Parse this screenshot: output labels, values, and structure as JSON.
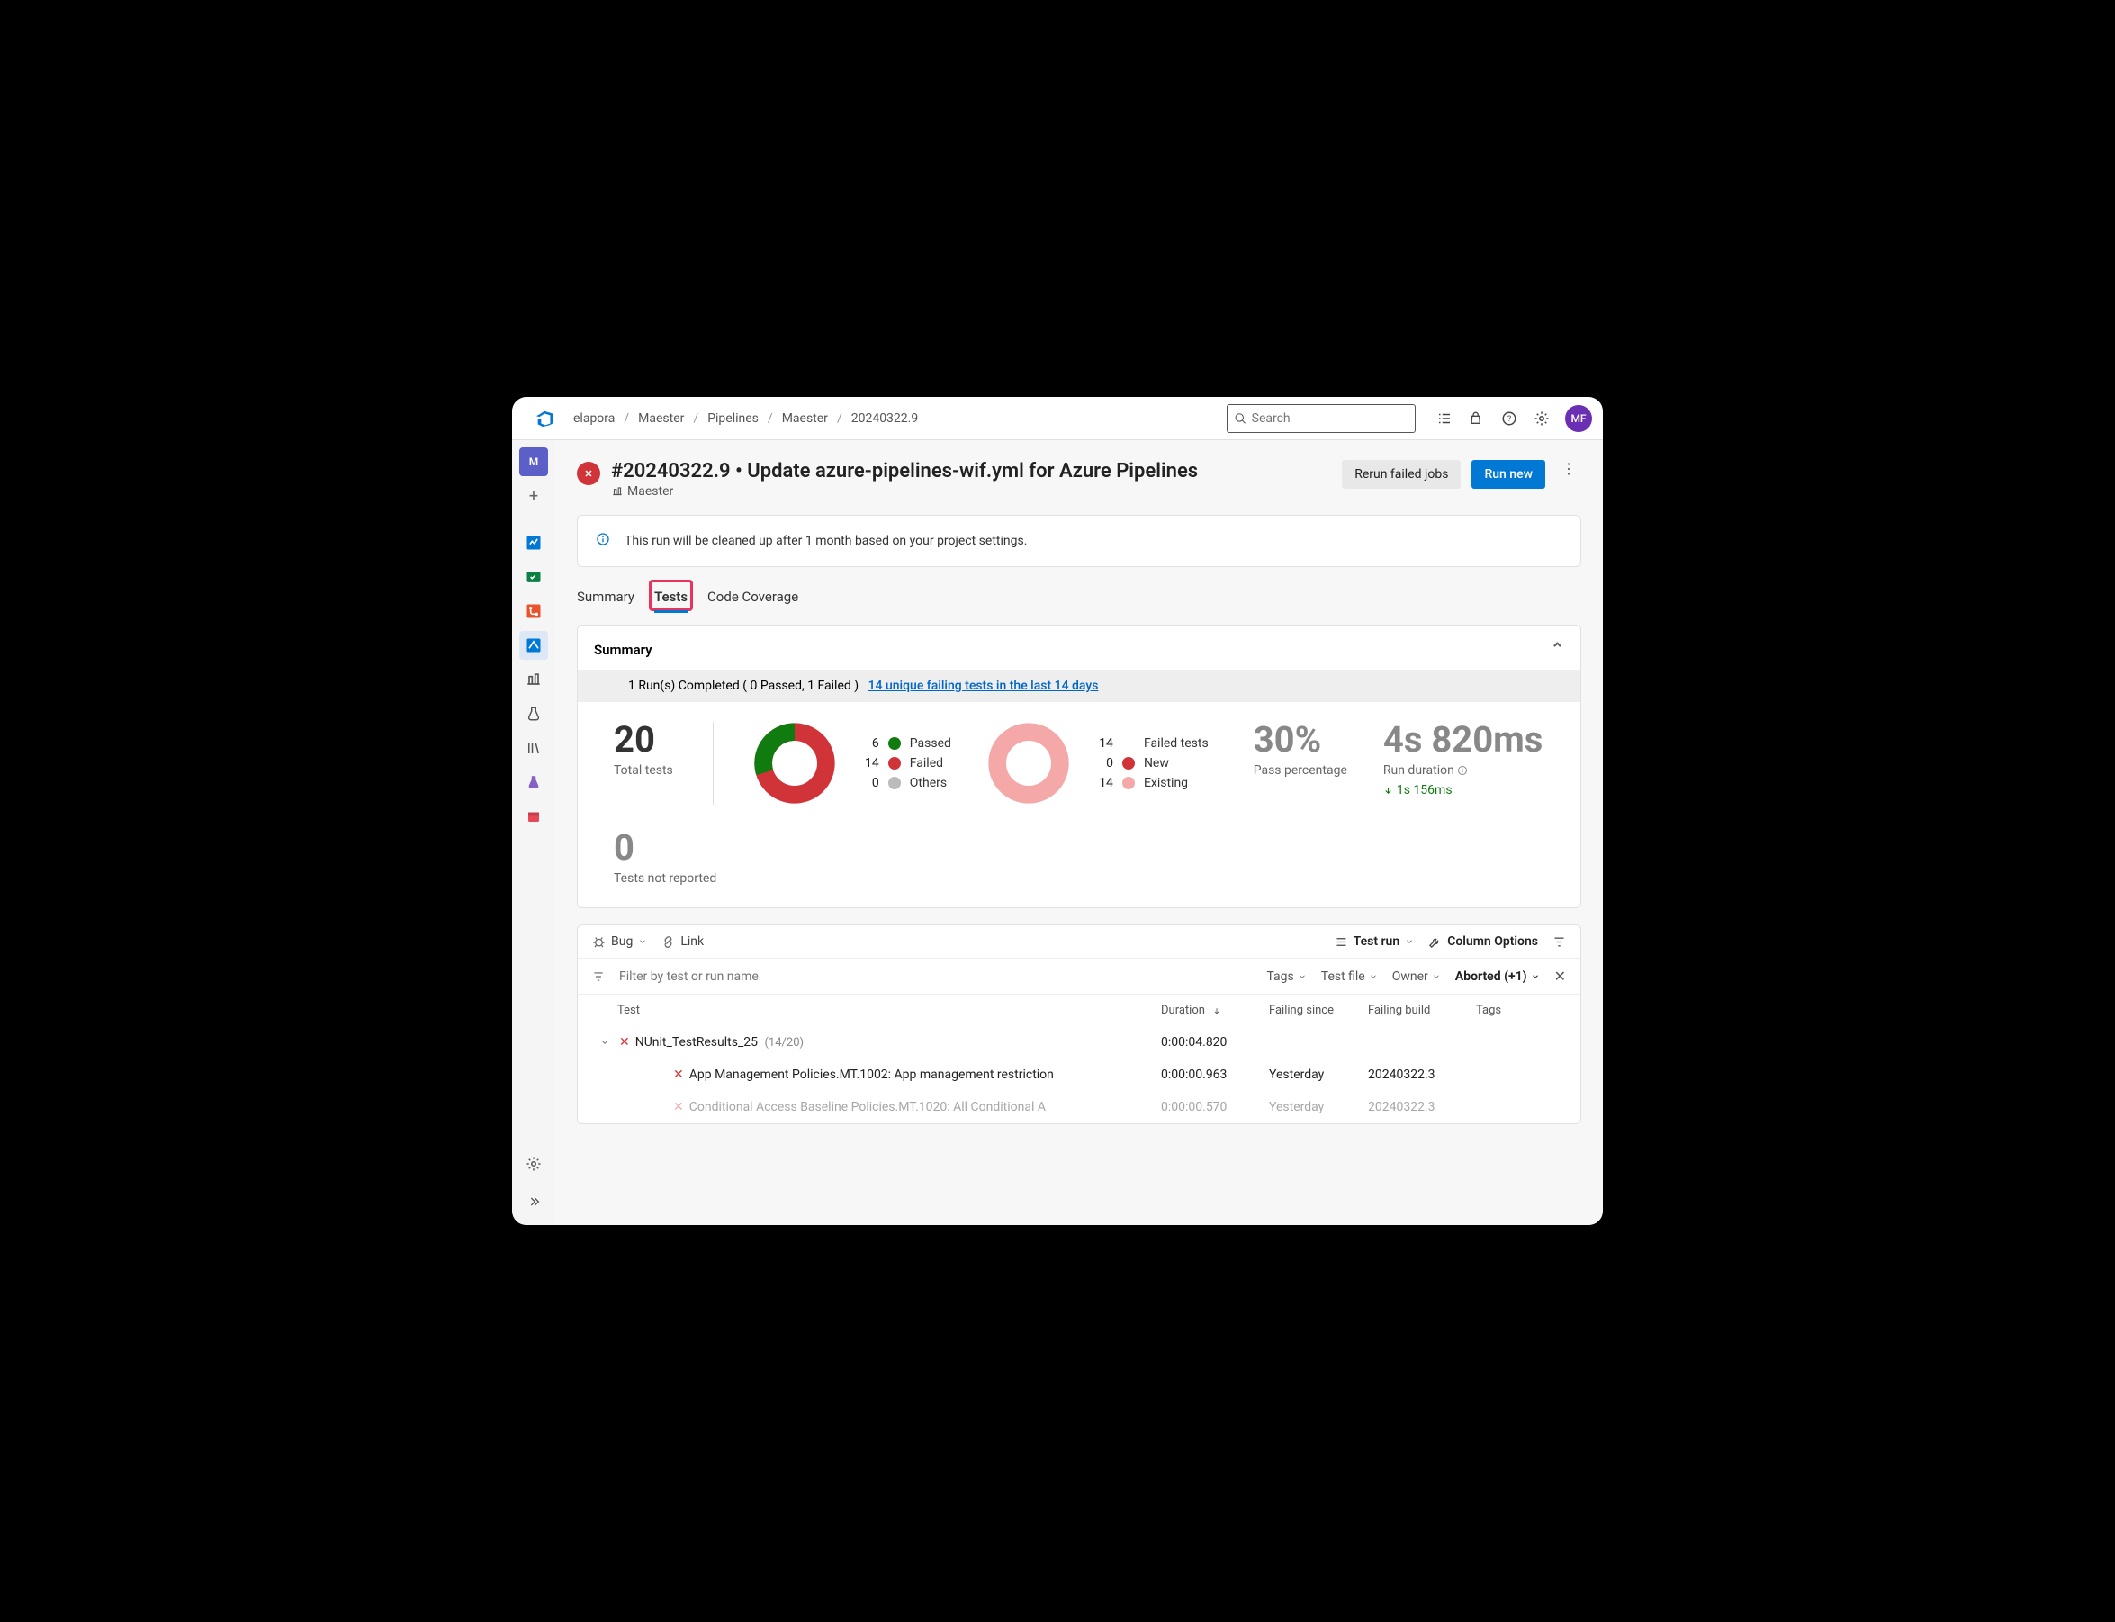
{
  "breadcrumbs": [
    "elapora",
    "Maester",
    "Pipelines",
    "Maester",
    "20240322.9"
  ],
  "search": {
    "placeholder": "Search"
  },
  "avatar": "MF",
  "run": {
    "title": "#20240322.9 • Update azure-pipelines-wif.yml for Azure Pipelines",
    "project": "Maester",
    "rerun_label": "Rerun failed jobs",
    "runnew_label": "Run new"
  },
  "banner": "This run will be cleaned up after 1 month based on your project settings.",
  "tabs": {
    "summary": "Summary",
    "tests": "Tests",
    "coverage": "Code Coverage"
  },
  "summary": {
    "heading": "Summary",
    "strip_text": "1 Run(s) Completed ( 0 Passed, 1 Failed )",
    "strip_link": "14 unique failing tests in the last 14 days",
    "total_tests": "20",
    "total_label": "Total tests",
    "not_reported": "0",
    "not_reported_label": "Tests not reported",
    "pass_pct": "30%",
    "pass_label": "Pass percentage",
    "duration": "4s 820ms",
    "duration_label": "Run duration",
    "duration_delta": "1s 156ms",
    "legend1": [
      {
        "n": "6",
        "label": "Passed",
        "color": "#107c10"
      },
      {
        "n": "14",
        "label": "Failed",
        "color": "#d13438"
      },
      {
        "n": "0",
        "label": "Others",
        "color": "#bbb"
      }
    ],
    "legend2": [
      {
        "n": "14",
        "label": "Failed tests",
        "color": null
      },
      {
        "n": "0",
        "label": "New",
        "color": "#d13438"
      },
      {
        "n": "14",
        "label": "Existing",
        "color": "#f4a8a8"
      }
    ]
  },
  "chart_data": [
    {
      "type": "pie",
      "title": "Test results",
      "series": [
        {
          "name": "Passed",
          "value": 6,
          "color": "#107c10"
        },
        {
          "name": "Failed",
          "value": 14,
          "color": "#d13438"
        },
        {
          "name": "Others",
          "value": 0,
          "color": "#bbb"
        }
      ]
    },
    {
      "type": "pie",
      "title": "Failed tests breakdown",
      "series": [
        {
          "name": "New",
          "value": 0,
          "color": "#d13438"
        },
        {
          "name": "Existing",
          "value": 14,
          "color": "#f4a8a8"
        }
      ]
    }
  ],
  "toolbar": {
    "bug": "Bug",
    "link": "Link",
    "testrun": "Test run",
    "cols": "Column Options"
  },
  "filters": {
    "placeholder": "Filter by test or run name",
    "tags": "Tags",
    "file": "Test file",
    "owner": "Owner",
    "status": "Aborted (+1)"
  },
  "cols": {
    "test": "Test",
    "duration": "Duration",
    "since": "Failing since",
    "build": "Failing build",
    "tags": "Tags"
  },
  "rows": {
    "group": {
      "name": "NUnit_TestResults_25",
      "count": "(14/20)",
      "duration": "0:00:04.820"
    },
    "r1": {
      "name": "App Management Policies.MT.1002: App management restriction",
      "duration": "0:00:00.963",
      "since": "Yesterday",
      "build": "20240322.3"
    },
    "r2": {
      "name": "Conditional Access Baseline Policies.MT.1020: All Conditional A",
      "duration": "0:00:00.570",
      "since": "Yesterday",
      "build": "20240322.3"
    }
  }
}
